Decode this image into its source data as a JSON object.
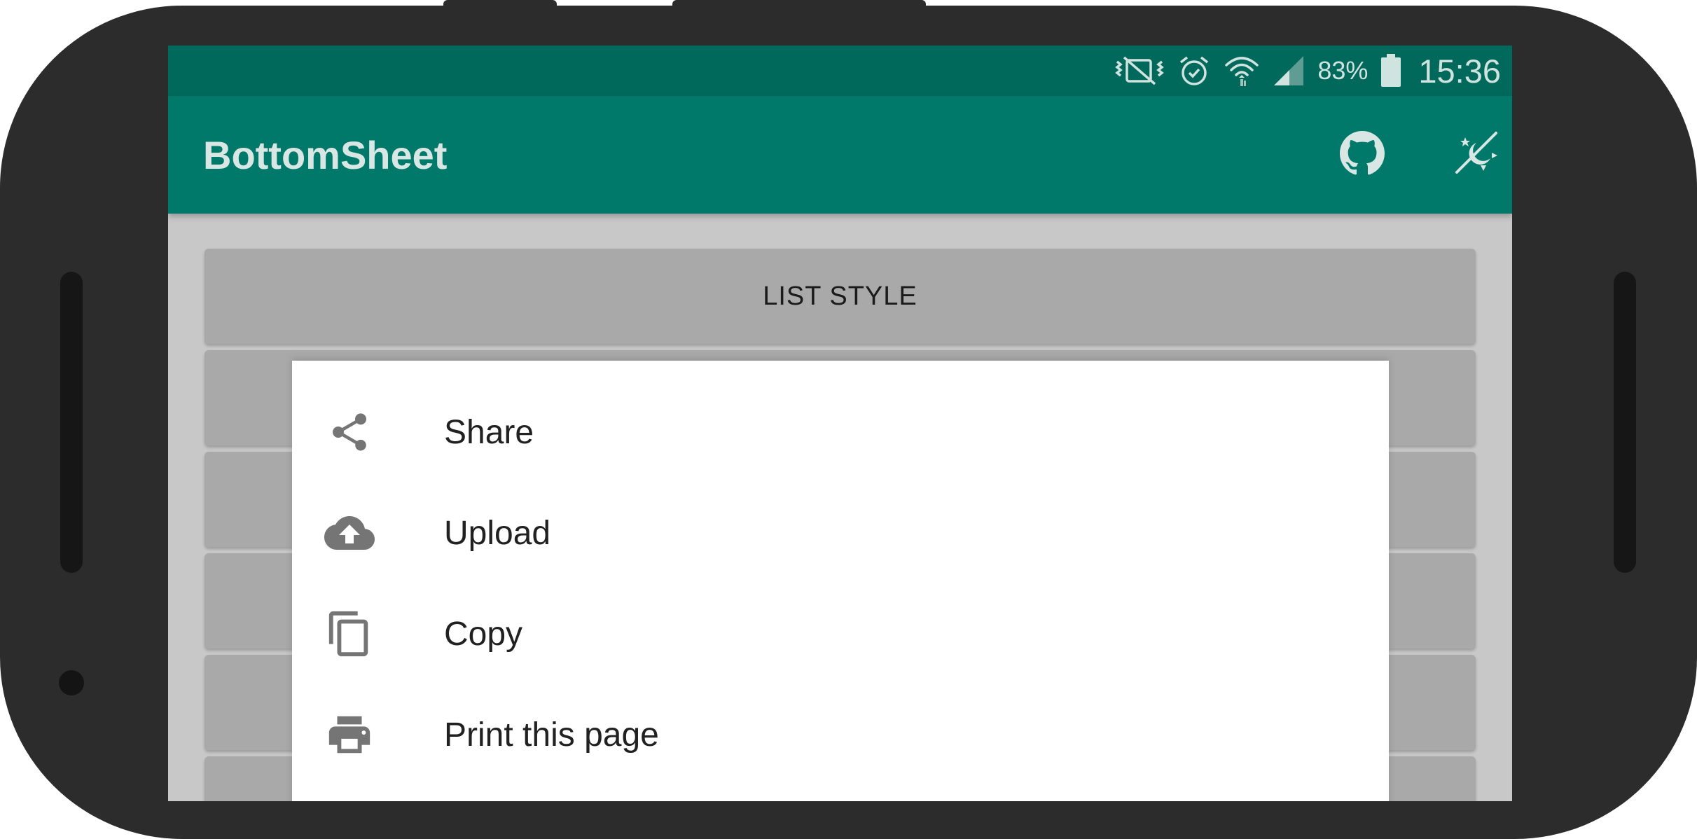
{
  "status_bar": {
    "battery_percent": "83%",
    "time": "15:36",
    "icons": [
      "vibrate-icon",
      "alarm-icon",
      "wifi-icon",
      "signal-icon",
      "battery-icon"
    ]
  },
  "app_bar": {
    "title": "BottomSheet",
    "actions": [
      "github-icon",
      "theme-toggle-icon"
    ],
    "color": "#00796b",
    "status_color": "#00695c"
  },
  "content": {
    "buttons": [
      "LIST STYLE",
      "",
      "",
      "",
      "",
      ""
    ]
  },
  "bottom_sheet": {
    "items": [
      {
        "label": "Share",
        "icon": "share-icon"
      },
      {
        "label": "Upload",
        "icon": "cloud-upload-icon"
      },
      {
        "label": "Copy",
        "icon": "copy-icon"
      },
      {
        "label": "Print this page",
        "icon": "print-icon"
      }
    ]
  }
}
